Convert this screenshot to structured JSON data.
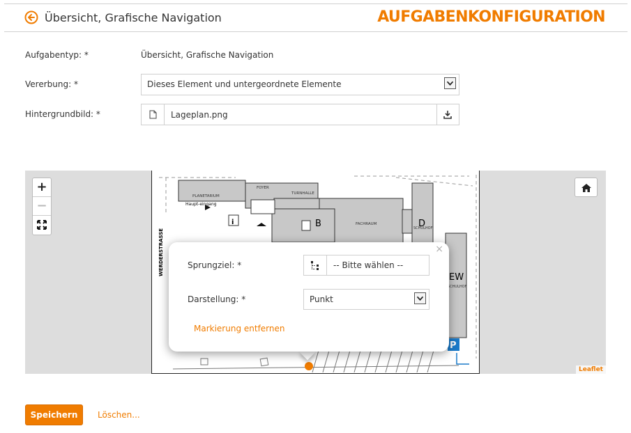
{
  "header": {
    "title": "Übersicht, Grafische Navigation",
    "brand": "AUFGABENKONFIGURATION",
    "accent_color": "#f07c00"
  },
  "form": {
    "task_type": {
      "label": "Aufgabentyp: *",
      "value": "Übersicht, Grafische Navigation"
    },
    "inheritance": {
      "label": "Vererbung: *",
      "value": "Dieses Element und untergeordnete Elemente"
    },
    "background": {
      "label": "Hintergrundbild: *",
      "file": "Lageplan.png"
    }
  },
  "map": {
    "zoom_in": "+",
    "zoom_out": "−",
    "attribution": "Leaflet",
    "plan_labels": {
      "street": "WERDERSTRASSE",
      "building_b": "B",
      "building_d": "D",
      "building_ew": "EW",
      "entrance": "Haupt-eingang",
      "parking": "P",
      "info": "i"
    }
  },
  "popup": {
    "target_label": "Sprungziel: *",
    "target_placeholder": "-- Bitte wählen --",
    "display_label": "Darstellung: *",
    "display_value": "Punkt",
    "remove_link": "Markierung entfernen",
    "close": "×"
  },
  "footer": {
    "save": "Speichern",
    "delete": "Löschen..."
  }
}
